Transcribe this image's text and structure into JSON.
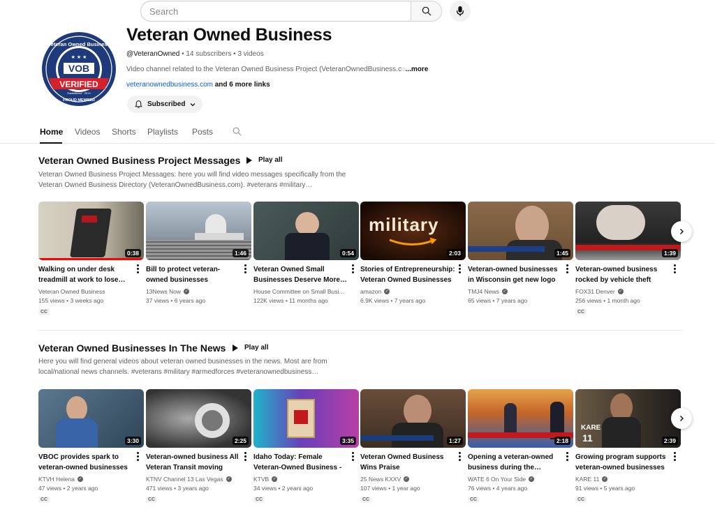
{
  "search": {
    "placeholder": "Search"
  },
  "channel": {
    "title": "Veteran Owned Business",
    "handle": "@VeteranOwned",
    "meta": " • 14 subscribers • 3 videos",
    "description": "Video channel related to the Veteran Owned Business Project (VeteranOwnedBusiness.c",
    "description_fade": "o",
    "more_label": "...more",
    "link_text": "veteranownedbusiness.com",
    "link_rest": " and 6 more links",
    "subscribe_label": "Subscribed",
    "avatar": {
      "top_text": "Veteran Owned Business",
      "badge": "VOB",
      "verified": "VERIFIED",
      "small_text": "Established · 2013",
      "bottom_text": "PROUD MEMBER"
    }
  },
  "tabs": [
    {
      "label": "Home"
    },
    {
      "label": "Videos"
    },
    {
      "label": "Shorts"
    },
    {
      "label": "Playlists"
    },
    {
      "label": "Posts"
    }
  ],
  "sections": [
    {
      "title": "Veteran Owned Business Project Messages",
      "play_all": "Play all",
      "description_line1": "Veteran Owned Business Project Messages: here you will find video messages specifically from the",
      "description_line2": "Veteran Owned Business Directory (VeteranOwnedBusiness.com). #veterans #military…",
      "videos": [
        {
          "title": "Walking on under desk treadmill at work to lose…",
          "channel": "Veteran Owned Business",
          "verified": false,
          "stats": "155 views • 3 weeks ago",
          "duration": "0:38",
          "cc": "CC",
          "progress": 1.0
        },
        {
          "title": "Bill to protect veteran-owned businesses",
          "channel": "13News Now",
          "verified": true,
          "stats": "37 views • 6 years ago",
          "duration": "1:46",
          "cc": ""
        },
        {
          "title": "Veteran Owned Small Businesses Deserve More…",
          "channel": "House Committee on Small Busi…",
          "verified": false,
          "stats": "122K views • 11 months ago",
          "duration": "0:54",
          "cc": ""
        },
        {
          "title": "Stories of Entrepreneurship: Veteran Owned Businesses",
          "channel": "amazon",
          "verified": true,
          "stats": "6.9K views • 7 years ago",
          "duration": "2:03",
          "cc": ""
        },
        {
          "title": "Veteran-owned businesses in Wisconsin get new logo",
          "channel": "TMJ4 News",
          "verified": true,
          "stats": "65 views • 7 years ago",
          "duration": "1:45",
          "cc": ""
        },
        {
          "title": "Veteran-owned business rocked by vehicle theft",
          "channel": "FOX31 Denver",
          "verified": true,
          "stats": "256 views • 1 month ago",
          "duration": "1:39",
          "cc": "CC"
        }
      ]
    },
    {
      "title": "Veteran Owned Businesses In The News",
      "play_all": "Play all",
      "description_line1": "Here you will find general videos about veteran owned businesses in the news. Most are from",
      "description_line2": "local/national news channels. #veterans #military #armedforces #veteranownedbusiness…",
      "videos": [
        {
          "title": "VBOC provides spark to veteran-owned businesses i…",
          "channel": "KTVH Helena",
          "verified": true,
          "stats": "47 views • 2 years ago",
          "duration": "3:30",
          "cc": "CC"
        },
        {
          "title": "Veteran-owned business All Veteran Transit moving Las…",
          "channel": "KTNV Channel 13 Las Vegas",
          "verified": true,
          "stats": "471 views • 3 years ago",
          "duration": "2:25",
          "cc": "CC"
        },
        {
          "title": "Idaho Today: Female Veteran-Owned Business - Empower…",
          "channel": "KTVB",
          "verified": true,
          "stats": "34 views • 2 years ago",
          "duration": "3:35",
          "cc": "CC"
        },
        {
          "title": "Veteran Owned Business Wins Praise",
          "channel": "25 News KXXV",
          "verified": true,
          "stats": "107 views • 1 year ago",
          "duration": "1:27",
          "cc": "CC"
        },
        {
          "title": "Opening a veteran-owned business during the…",
          "channel": "WATE 6 On Your Side",
          "verified": true,
          "stats": "76 views • 4 years ago",
          "duration": "2:18",
          "cc": "CC"
        },
        {
          "title": "Growing program supports veteran-owned businesses i…",
          "channel": "KARE 11",
          "verified": true,
          "stats": "91 views • 5 years ago",
          "duration": "2:39",
          "cc": "CC"
        }
      ]
    }
  ],
  "thumb_text": {
    "military": "military",
    "kare": "KARE",
    "eleven": "11"
  },
  "colors": {
    "accent_link": "#065fd4",
    "progress": "#ff0000",
    "text_primary": "#0f0f0f",
    "text_secondary": "#606060"
  }
}
